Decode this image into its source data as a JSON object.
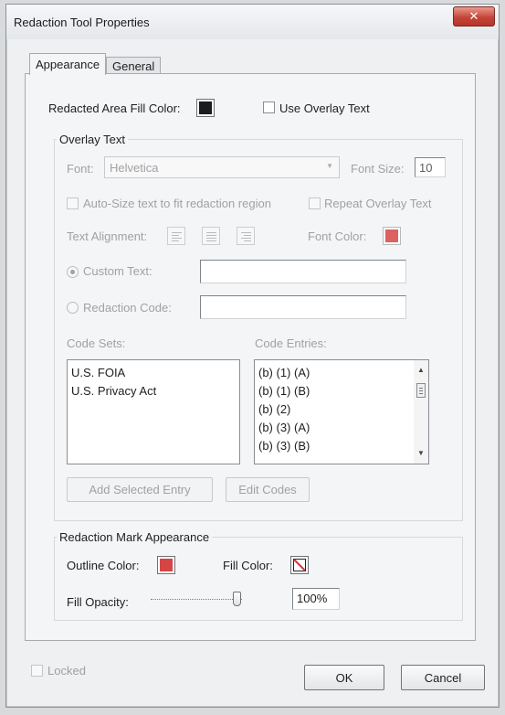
{
  "window": {
    "title": "Redaction Tool Properties",
    "close_symbol": "✕"
  },
  "tabs": [
    {
      "label": "Appearance",
      "active": true
    },
    {
      "label": "General",
      "active": false
    }
  ],
  "appearance": {
    "fill_color_label": "Redacted Area Fill Color:",
    "fill_color": "#1c1c1c",
    "use_overlay_text_label": "Use Overlay Text",
    "use_overlay_text_checked": false
  },
  "overlay_text": {
    "group_title": "Overlay Text",
    "font_label": "Font:",
    "font_value": "Helvetica",
    "font_size_label": "Font Size:",
    "font_size_value": "10",
    "auto_size_label": "Auto-Size text to fit redaction region",
    "repeat_label": "Repeat Overlay Text",
    "text_alignment_label": "Text Alignment:",
    "font_color_label": "Font Color:",
    "font_color": "#d64545",
    "custom_text_label": "Custom Text:",
    "custom_text_value": "",
    "redaction_code_label": "Redaction Code:",
    "redaction_code_value": "",
    "code_sets_label": "Code Sets:",
    "code_sets": [
      "U.S. FOIA",
      "U.S. Privacy Act"
    ],
    "code_entries_label": "Code Entries:",
    "code_entries": [
      "(b) (1) (A)",
      "(b) (1) (B)",
      "(b) (2)",
      "(b) (3) (A)",
      "(b) (3) (B)"
    ],
    "add_selected_entry_label": "Add Selected Entry",
    "edit_codes_label": "Edit Codes"
  },
  "mark_appearance": {
    "group_title": "Redaction Mark Appearance",
    "outline_color_label": "Outline Color:",
    "outline_color": "#d64545",
    "fill_color_label": "Fill Color:",
    "fill_opacity_label": "Fill Opacity:",
    "fill_opacity_value": "100%",
    "fill_opacity_fraction": 1.0
  },
  "footer": {
    "locked_label": "Locked",
    "ok_label": "OK",
    "cancel_label": "Cancel"
  }
}
